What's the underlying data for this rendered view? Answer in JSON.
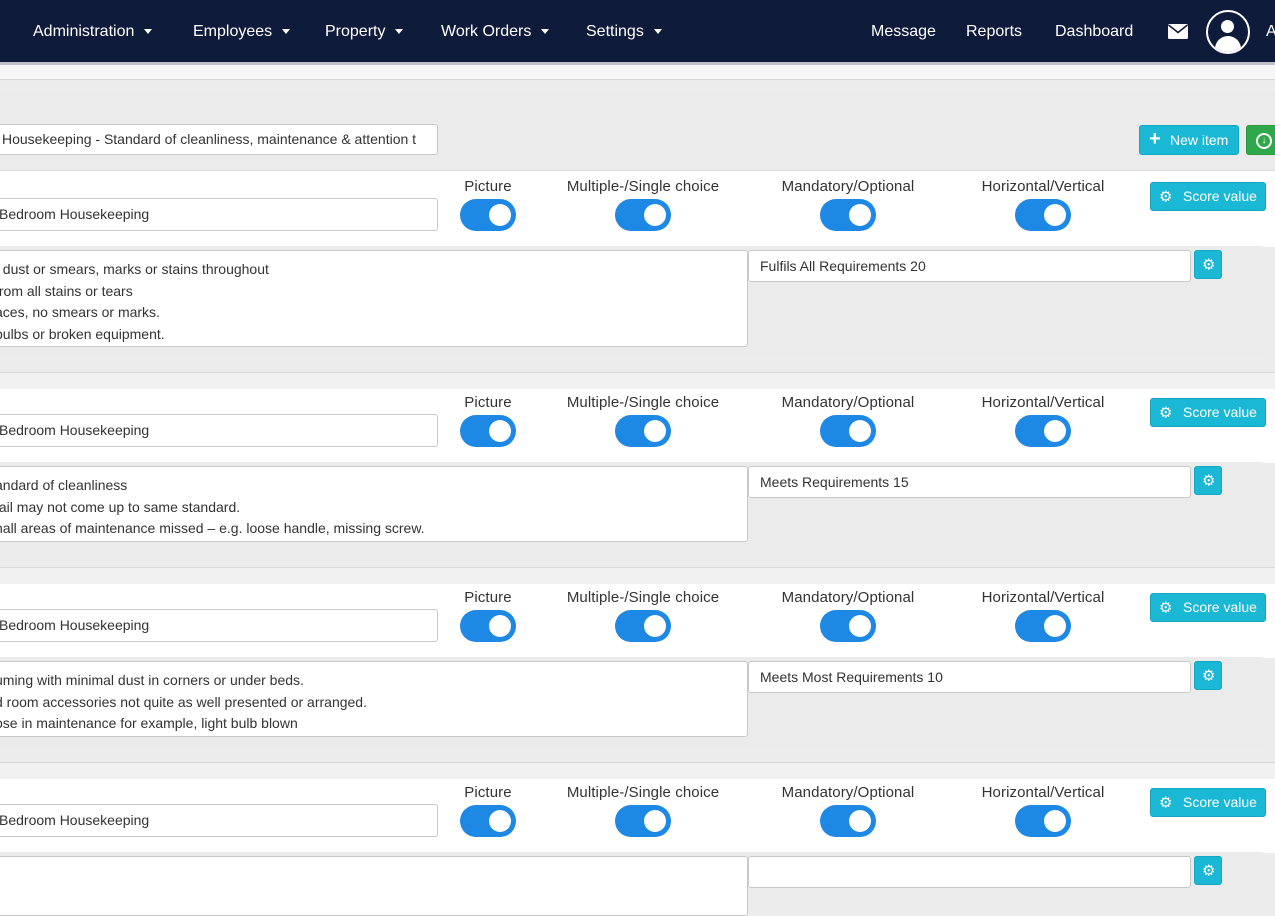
{
  "nav": {
    "items": [
      {
        "label": "Administration"
      },
      {
        "label": "Employees"
      },
      {
        "label": "Property"
      },
      {
        "label": "Work Orders"
      },
      {
        "label": "Settings"
      }
    ],
    "right": [
      {
        "label": "Message"
      },
      {
        "label": "Reports"
      },
      {
        "label": "Dashboard"
      }
    ],
    "user_initial": "A",
    "icons": [
      "envelope-icon",
      "user-avatar-icon"
    ],
    "bg_color": "#0f1b3a"
  },
  "header": {
    "title_value": "Housekeeping - Standard of cleanliness, maintenance & attention t",
    "new_item_label": "New item",
    "download_icon": "download-circle-icon"
  },
  "toggle_labels": {
    "picture": "Picture",
    "choice": "Multiple-/Single choice",
    "mandatory": "Mandatory/Optional",
    "orientation": "Horizontal/Vertical"
  },
  "score_label": "Score value",
  "accent_colors": {
    "info": "#1bb8d6",
    "toggle": "#1e88e5",
    "success": "#2ea84a"
  },
  "cards": [
    {
      "category": "Bedroom Housekeeping",
      "toggles": {
        "picture": true,
        "choice": true,
        "mandatory": true,
        "orientation": true
      },
      "description": [
        "f dust or smears, marks or stains throughout",
        " from all stains or tears",
        "aces, no smears or marks.",
        " bulbs or broken equipment."
      ],
      "answer": "Fulfils All Requirements 20"
    },
    {
      "category": "Bedroom Housekeeping",
      "toggles": {
        "picture": true,
        "choice": true,
        "mandatory": true,
        "orientation": true
      },
      "description": [
        "andard of cleanliness",
        "tail may not come up to same standard.",
        "nall areas of maintenance missed – e.g. loose handle, missing screw."
      ],
      "answer": "Meets Requirements 15"
    },
    {
      "category": "Bedroom Housekeeping",
      "toggles": {
        "picture": true,
        "choice": true,
        "mandatory": true,
        "orientation": true
      },
      "description": [
        "uming with minimal dust in corners or under beds.",
        "d room accessories not quite as well presented or arranged.",
        "ose in maintenance for example, light bulb blown"
      ],
      "answer": "Meets Most Requirements 10"
    },
    {
      "category": "Bedroom Housekeeping",
      "toggles": {
        "picture": true,
        "choice": true,
        "mandatory": true,
        "orientation": true
      },
      "description": [],
      "answer": ""
    }
  ]
}
